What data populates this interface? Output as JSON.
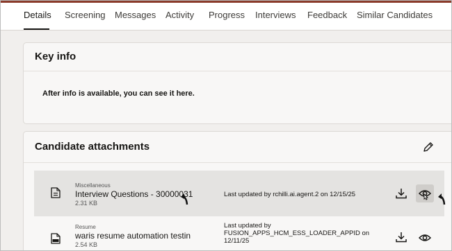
{
  "tabs": [
    {
      "label": "Details",
      "active": true
    },
    {
      "label": "Screening"
    },
    {
      "label": "Messages"
    },
    {
      "label": "Activity"
    },
    {
      "label": "Progress"
    },
    {
      "label": "Interviews"
    },
    {
      "label": "Feedback"
    },
    {
      "label": "Similar Candidates"
    }
  ],
  "key_info": {
    "title": "Key info",
    "empty_message": "After info is available, you can see it here."
  },
  "attachments": {
    "title": "Candidate attachments",
    "edit_icon": "pencil-icon",
    "items": [
      {
        "category": "Miscellaneous",
        "name": "Interview Questions - 30000031",
        "size": "2.31 KB",
        "updated": "Last updated by rchilli.ai.agent.2 on 12/15/25",
        "file_icon": "document-icon",
        "hovered": true
      },
      {
        "category": "Resume",
        "name": "waris resume automation testin",
        "size": "2.54 KB",
        "updated_line1": "Last updated by",
        "updated_line2": "FUSION_APPS_HCM_ESS_LOADER_APPID on",
        "updated_line3": "12/11/25",
        "file_icon": "doc-file-icon"
      }
    ]
  },
  "colors": {
    "background": "#f1efed",
    "card": "#f8f7f6",
    "hover_row": "#e4e3e1",
    "text": "#161513"
  }
}
